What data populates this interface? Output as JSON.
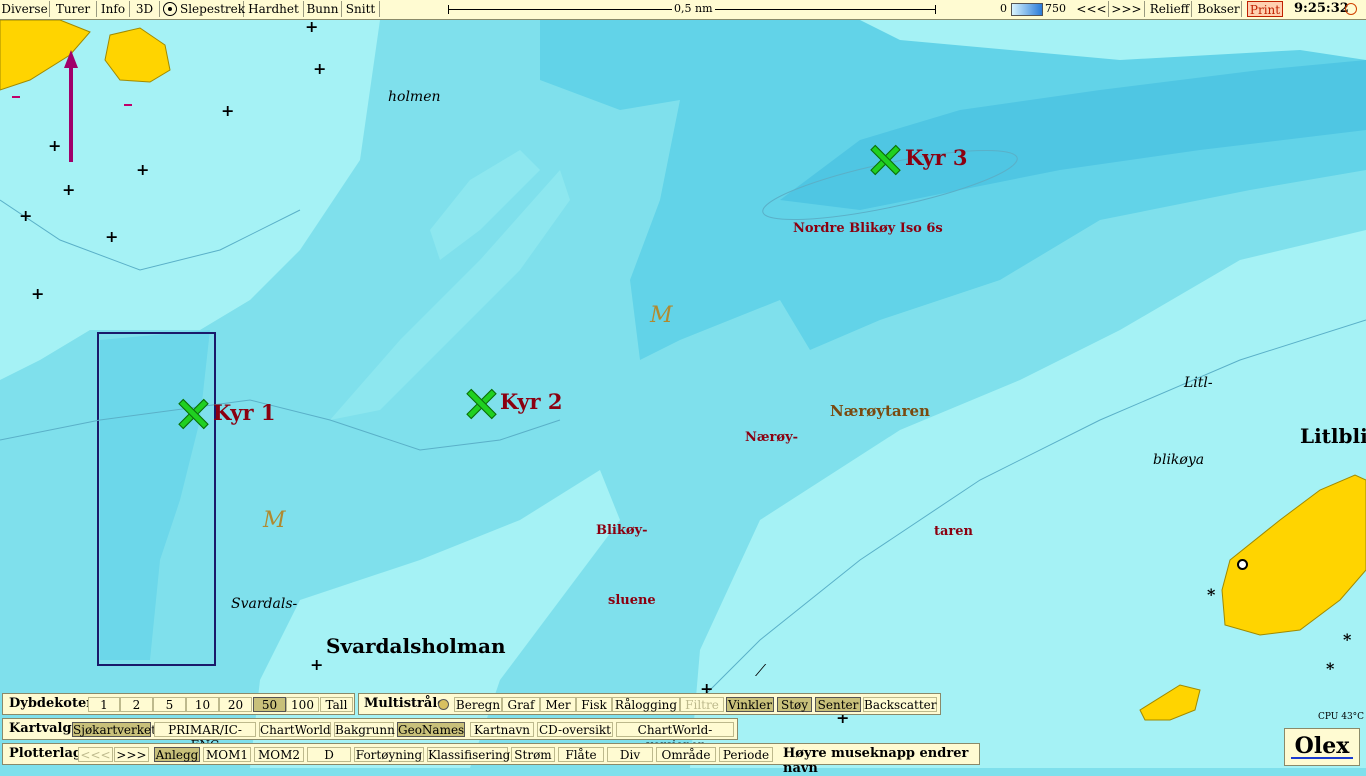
{
  "toolbar": {
    "buttons": [
      "Diverse",
      "Turer",
      "Info",
      "3D",
      "Slepestrek",
      "Hardhet",
      "Bunn",
      "Snitt"
    ],
    "scale_label": "0,5 nm",
    "depth_min": "0",
    "depth_max": "750",
    "right_buttons": [
      "<<<",
      ">>>",
      "Relieff",
      "Bokser",
      "Print"
    ],
    "clock": "9:25:32"
  },
  "map": {
    "place_names": {
      "holmen": "holmen",
      "svardals": "Svardals-",
      "svardalsholman": "Svardalsholman",
      "litl": "Litl-",
      "blikoya": "blikøya",
      "litlbli": "Litlbli",
      "naeroytaren": "Nærøytaren",
      "naeroy": "Nærøy-",
      "taren": "taren",
      "blikoy": "Blikøy-",
      "sluene": "sluene",
      "light": "Nordre Blikøy Iso 6s"
    },
    "marks": {
      "kyr1": "Kyr 1",
      "kyr2": "Kyr 2",
      "kyr3": "Kyr 3"
    },
    "seabed_symbol": "M"
  },
  "panels": {
    "dybdekoter": {
      "title": "Dybdekoter",
      "buttons": [
        "1",
        "2",
        "5",
        "10",
        "20",
        "50",
        "100",
        "Tall"
      ],
      "active": "50"
    },
    "multistrale": {
      "title": "Multistråle",
      "buttons": [
        "Beregn",
        "Graf",
        "Mer",
        "Fisk",
        "Rålogging",
        "Filtre",
        "Vinkler",
        "Støy",
        "Senter",
        "Backscatter"
      ]
    },
    "kartvalg": {
      "title": "Kartvalg",
      "buttons": [
        "Sjøkartverket",
        "PRIMAR/IC-ENC",
        "ChartWorld",
        "Bakgrunn",
        "GeoNames",
        "Kartnavn",
        "CD-oversikt",
        "ChartWorld-versjoner"
      ]
    },
    "plotterlag": {
      "title": "Plotterlag",
      "buttons": [
        "<<<",
        ">>>",
        "Anlegg",
        "MOM1",
        "MOM2",
        "D",
        "Fortøyning",
        "Klassifisering",
        "Strøm",
        "Flåte",
        "Div",
        "Område",
        "Periode"
      ],
      "hint": "Høyre museknapp endrer navn"
    }
  },
  "status": {
    "cpu": "CPU 43°C",
    "brand": "Olex"
  },
  "colors": {
    "sea_light": "#9ef0f4",
    "sea_mid": "#7fe0ec",
    "sea_deep": "#5ccfe6",
    "land": "#ffd400",
    "label_red": "#8b0010",
    "mark_green": "#20d020"
  }
}
